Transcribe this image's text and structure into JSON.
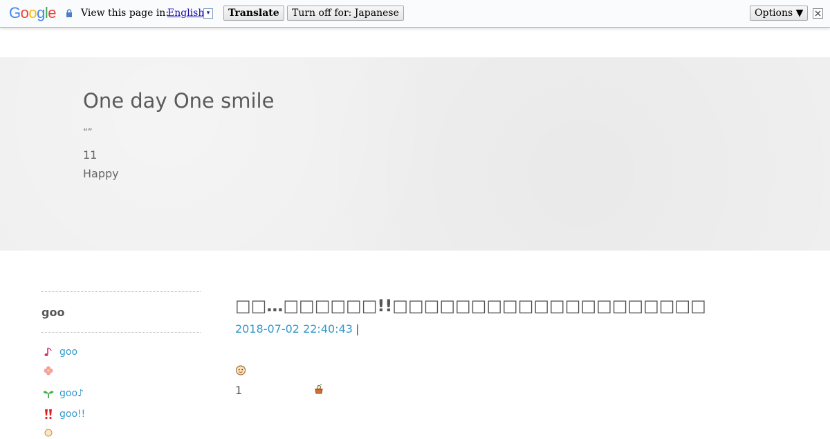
{
  "translate_bar": {
    "logo": [
      "G",
      "o",
      "o",
      "g",
      "l",
      "e"
    ],
    "view_label": "View this page in:",
    "language": "English",
    "dropdown_glyph": "▾",
    "translate_button": "Translate",
    "turnoff_button": "Turn off for: Japanese",
    "options_button": "Options ▼",
    "close_icon": "close-icon",
    "lock_icon": "lock-icon"
  },
  "header": {
    "title": "One day One smile",
    "desc_line1": "“”",
    "desc_line2": "11",
    "desc_line3": "Happy"
  },
  "sidebar": {
    "title": "goo",
    "items": [
      {
        "icon": "music-note-icon",
        "label": "goo",
        "color": "#cc3377"
      },
      {
        "icon": "flower-icon",
        "label": "",
        "color": "#f08080"
      },
      {
        "icon": "sprout-icon",
        "label": "goo♪",
        "color": "#2a9a2a"
      },
      {
        "icon": "exclamation-icon",
        "label": "goo!!",
        "color": "#e02020"
      },
      {
        "icon": "smile-face-icon",
        "label": "",
        "color": "#e0b060"
      }
    ]
  },
  "post": {
    "title": "□□…□□□□□□!!□□□□□□□□□□□□□□□□□□□□",
    "date": "2018-07-02 22:40:43",
    "separator": "|",
    "number": "1"
  },
  "colors": {
    "link": "#3399cc",
    "header_bg": "#efefef",
    "text": "#555555"
  }
}
